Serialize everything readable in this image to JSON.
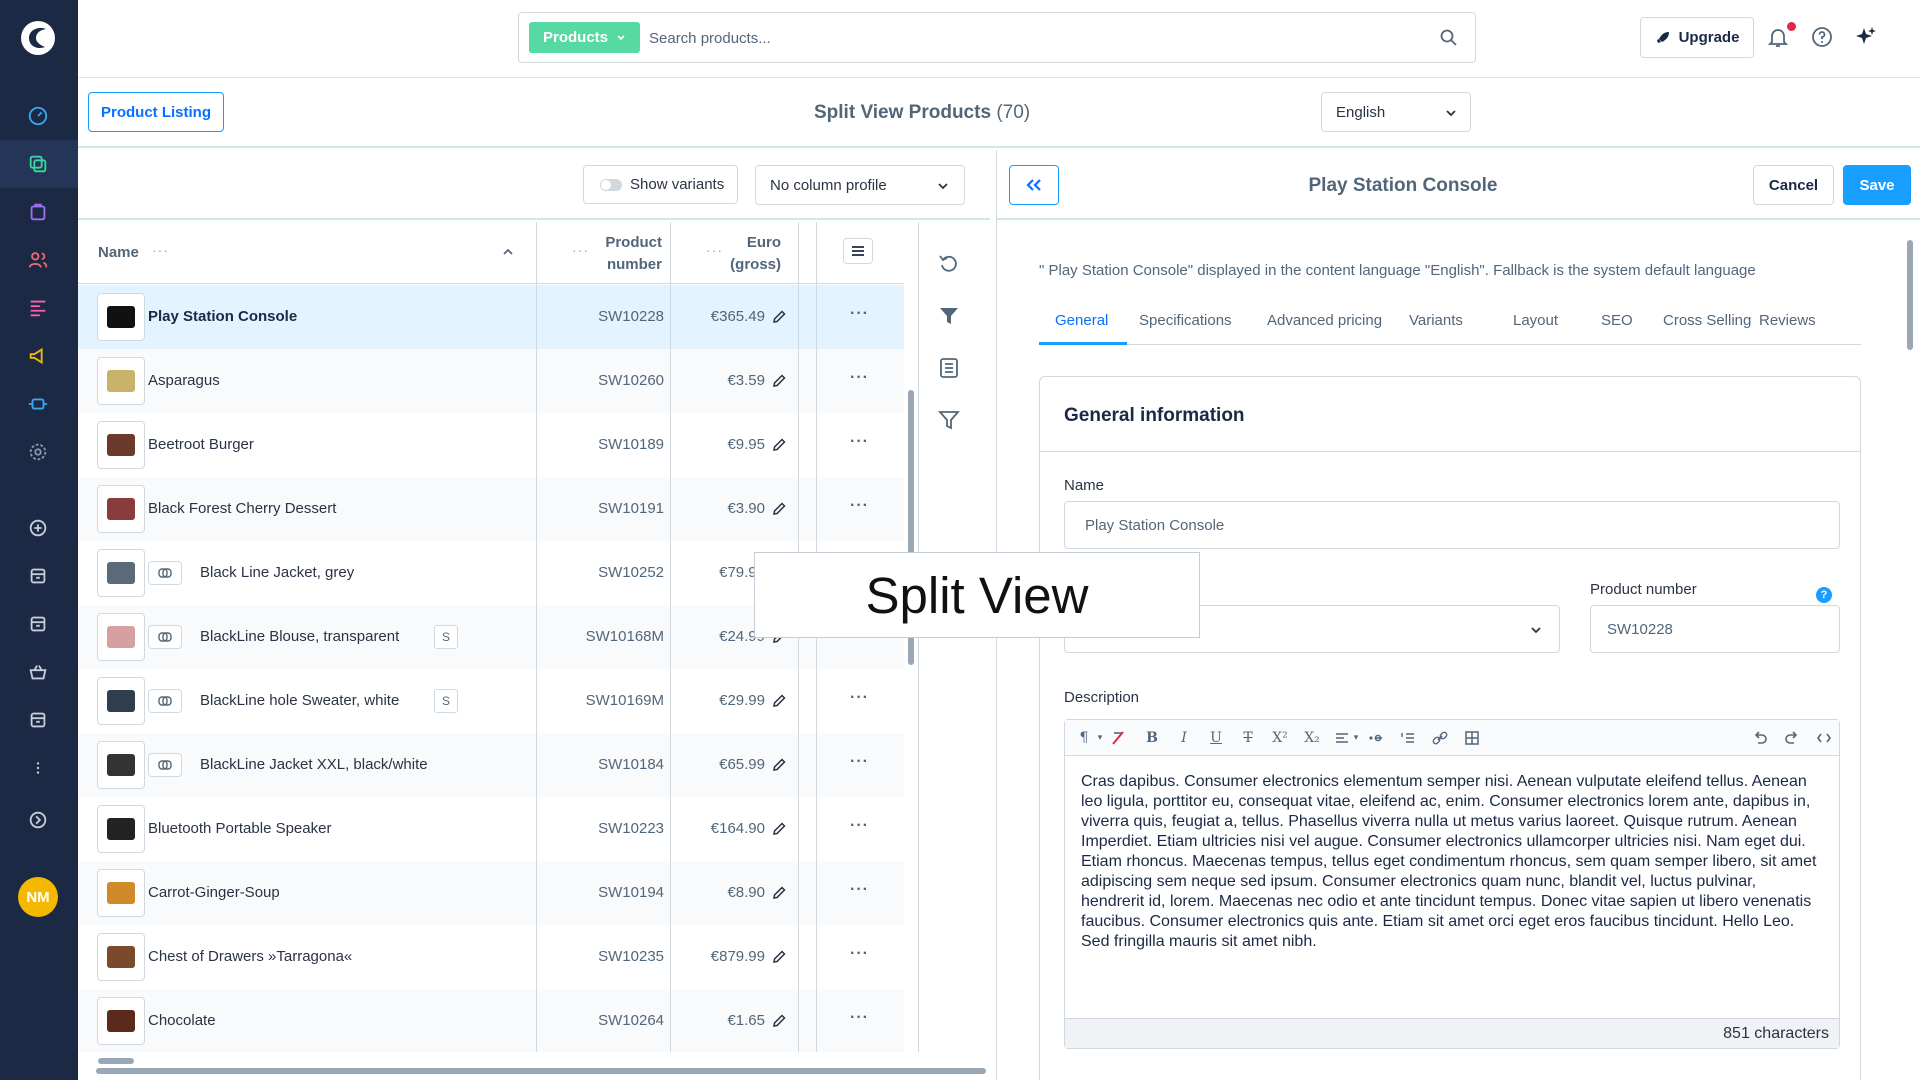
{
  "topbar": {
    "search_type": "Products",
    "search_placeholder": "Search products...",
    "upgrade_label": "Upgrade"
  },
  "sidebar": {
    "avatar_initials": "NM",
    "items": [
      "dashboard-icon",
      "catalogue-icon",
      "orders-icon",
      "customers-icon",
      "content-icon",
      "marketing-icon",
      "extensions-icon",
      "settings-icon",
      "add-icon",
      "sales-channel-icon",
      "sales-channel-icon",
      "shop-icon",
      "sales-channel-icon",
      "more-icon",
      "help-icon"
    ]
  },
  "header": {
    "listing_button": "Product Listing",
    "title": "Split View Products",
    "count": "(70)",
    "language": "English"
  },
  "list": {
    "show_variants": "Show variants",
    "column_profile": "No column profile",
    "columns": {
      "name": "Name",
      "product_number": [
        "Product",
        "number"
      ],
      "price": [
        "Euro",
        "(gross)"
      ]
    },
    "rows": [
      {
        "name": "Play Station Console",
        "number": "SW10228",
        "price": "€365.49",
        "variant": false,
        "badge": "",
        "bold": true
      },
      {
        "name": "Asparagus",
        "number": "SW10260",
        "price": "€3.59",
        "variant": false,
        "badge": "",
        "bold": false
      },
      {
        "name": "Beetroot Burger",
        "number": "SW10189",
        "price": "€9.95",
        "variant": false,
        "badge": "",
        "bold": false
      },
      {
        "name": "Black Forest Cherry Dessert",
        "number": "SW10191",
        "price": "€3.90",
        "variant": false,
        "badge": "",
        "bold": false
      },
      {
        "name": "Black Line Jacket, grey",
        "number": "SW10252",
        "price": "€79.99",
        "variant": true,
        "badge": "",
        "bold": false
      },
      {
        "name": "BlackLine Blouse, transparent",
        "number": "SW10168M",
        "price": "€24.99",
        "variant": true,
        "badge": "S",
        "bold": false
      },
      {
        "name": "BlackLine hole Sweater, white",
        "number": "SW10169M",
        "price": "€29.99",
        "variant": true,
        "badge": "S",
        "bold": false
      },
      {
        "name": "BlackLine Jacket XXL, black/white",
        "number": "SW10184",
        "price": "€65.99",
        "variant": true,
        "badge": "",
        "bold": false
      },
      {
        "name": "Bluetooth Portable Speaker",
        "number": "SW10223",
        "price": "€164.90",
        "variant": false,
        "badge": "",
        "bold": false
      },
      {
        "name": "Carrot-Ginger-Soup",
        "number": "SW10194",
        "price": "€8.90",
        "variant": false,
        "badge": "",
        "bold": false
      },
      {
        "name": "Chest of Drawers »Tarragona«",
        "number": "SW10235",
        "price": "€879.99",
        "variant": false,
        "badge": "",
        "bold": false
      },
      {
        "name": "Chocolate",
        "number": "SW10264",
        "price": "€1.65",
        "variant": false,
        "badge": "",
        "bold": false
      }
    ]
  },
  "split_label": "Split View",
  "detail": {
    "title": "Play Station Console",
    "cancel": "Cancel",
    "save": "Save",
    "language_note": "\" Play Station Console\" displayed in the content language \"English\". Fallback is the system default language",
    "tabs": [
      "General",
      "Specifications",
      "Advanced pricing",
      "Variants",
      "Layout",
      "SEO",
      "Cross Selling",
      "Reviews"
    ],
    "card_title": "General information",
    "name_label": "Name",
    "name_value": "Play Station Console",
    "product_number_label": "Product number",
    "product_number_value": "SW10228",
    "description_label": "Description",
    "description": "Cras dapibus. Consumer electronics elementum semper nisi. Aenean vulputate eleifend tellus. Aenean leo ligula, porttitor eu, consequat vitae, eleifend ac, enim. Consumer electronics lorem ante, dapibus in, viverra quis, feugiat a, tellus. Phasellus viverra nulla ut metus varius laoreet. Quisque rutrum. Aenean Imperdiet. Etiam ultricies nisi vel augue. Consumer electronics ullamcorper ultricies nisi. Nam eget dui. Etiam rhoncus. Maecenas tempus, tellus eget condimentum rhoncus, sem quam semper libero, sit amet adipiscing sem neque sed ipsum. Consumer electronics quam nunc, blandit vel, luctus pulvinar, hendrerit id, lorem. Maecenas nec odio et ante tincidunt tempus. Donec vitae sapien ut libero venenatis faucibus. Consumer electronics quis ante. Etiam sit amet orci eget eros faucibus tincidunt. Hello Leo. Sed fringilla mauris sit amet nibh.",
    "char_count": "851 characters"
  },
  "colors": {
    "sidebar": "#1b2945",
    "accent": "#189eff",
    "products_badge": "#57d9a3"
  }
}
